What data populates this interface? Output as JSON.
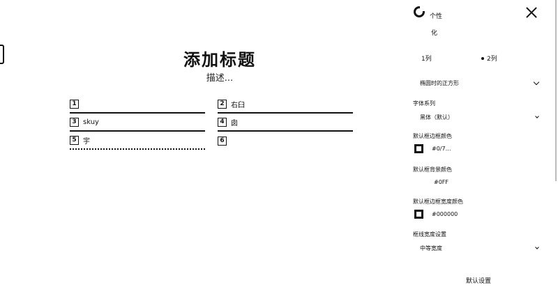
{
  "canvas": {
    "title": "添加标题",
    "description": "描述...",
    "items": [
      {
        "num": "1",
        "text": "",
        "underline": "solid"
      },
      {
        "num": "2",
        "text": "右臼",
        "underline": "solid"
      },
      {
        "num": "3",
        "text": "skuy",
        "underline": "solid"
      },
      {
        "num": "4",
        "text": "囱",
        "underline": "solid"
      },
      {
        "num": "5",
        "text": "宇",
        "underline": "dotted"
      },
      {
        "num": "6",
        "text": "",
        "underline": "none"
      }
    ]
  },
  "panel": {
    "title_line1": "个性",
    "title_line2": "化",
    "radio_option1": "1列",
    "radio_option2": "2列",
    "layout_select": "椭圆时的正方形",
    "font_family_label": "字体系列",
    "font_family_value": "黑体（默认）",
    "text_color_label": "默认框边框颜色",
    "text_color_value": "#0/7…",
    "border_color_label": "默认框背景颜色",
    "border_color_value": "#0FF",
    "bg_color_label": "默认框边框宽度颜色",
    "bg_color_value": "#000000",
    "border_width_label": "框线宽度设置",
    "border_width_value": "中等宽度",
    "reset_label": "默认设置"
  }
}
